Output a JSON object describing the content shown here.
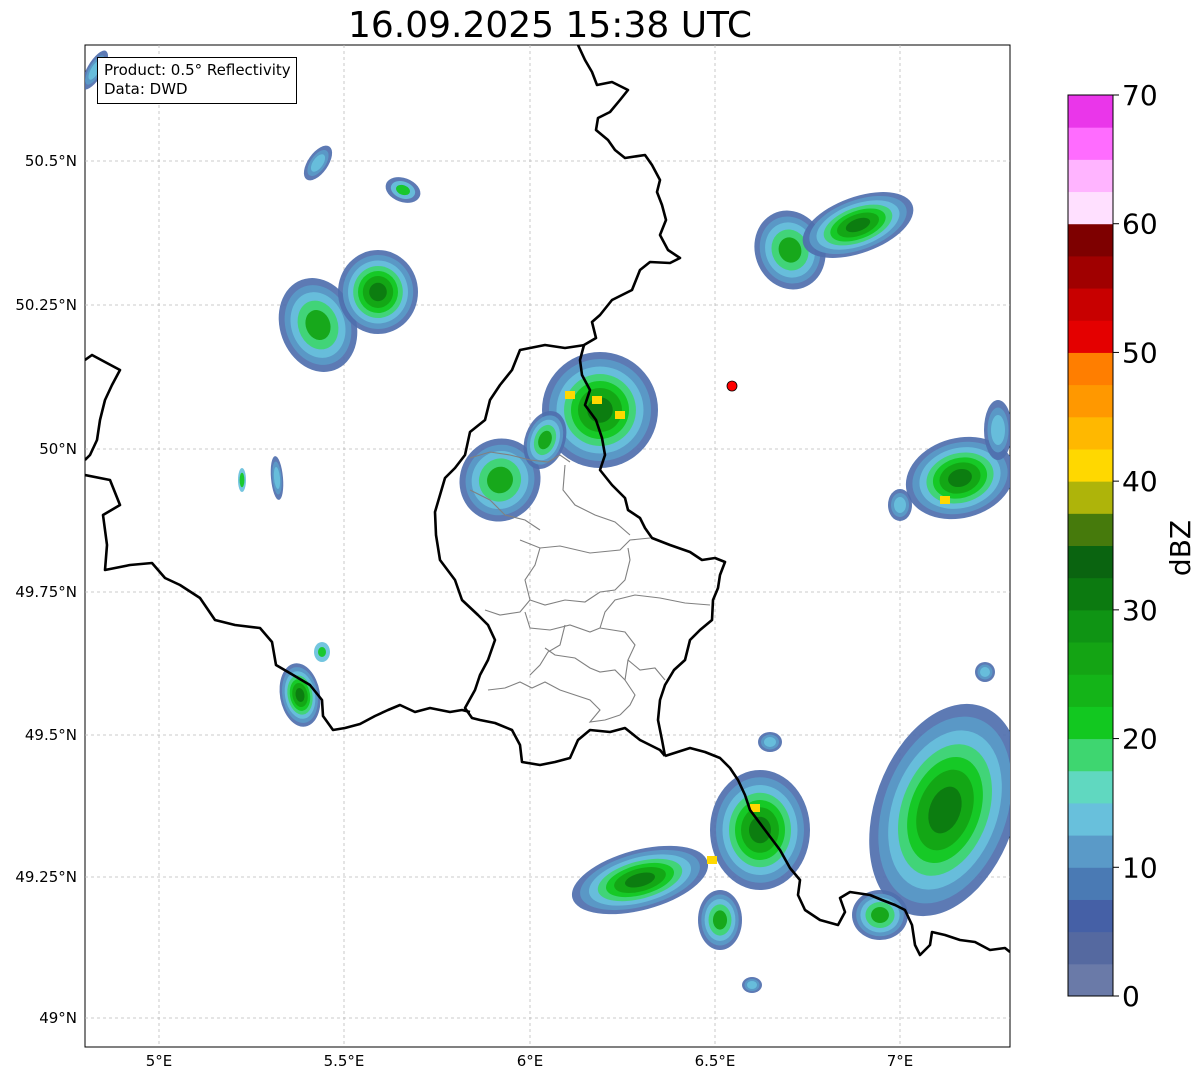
{
  "title": "16.09.2025 15:38 UTC",
  "info_box": {
    "product": "Product: 0.5° Reflectivity",
    "data": "Data: DWD"
  },
  "axes": {
    "lon_ticks": [
      "5°E",
      "5.5°E",
      "6°E",
      "6.5°E",
      "7°E"
    ],
    "lat_ticks": [
      "50.5°N",
      "50.25°N",
      "50°N",
      "49.75°N",
      "49.5°N",
      "49.25°N",
      "49°N"
    ]
  },
  "colorbar": {
    "label": "dBZ",
    "ticks": [
      "0",
      "10",
      "20",
      "30",
      "40",
      "50",
      "60",
      "70"
    ],
    "colors": [
      "#6a7aa8",
      "#5569a0",
      "#4560a6",
      "#4a7ab4",
      "#5a9ac8",
      "#68c0dc",
      "#60d8c0",
      "#3ed670",
      "#12c820",
      "#14b418",
      "#14a414",
      "#0f9414",
      "#0c7a10",
      "#0a6410",
      "#467a0c",
      "#aeb40a",
      "#ffd800",
      "#ffb800",
      "#ff9800",
      "#ff7e00",
      "#e40000",
      "#c80000",
      "#a00000",
      "#7e0000",
      "#ffe0ff",
      "#ffb4ff",
      "#ff6cff",
      "#ea36ea"
    ]
  },
  "marker": {
    "name": "radar-site",
    "color": "#ff0000"
  },
  "map_colors": {
    "border": "#000000",
    "admin": "#808080",
    "grid": "#bbbbbb"
  }
}
